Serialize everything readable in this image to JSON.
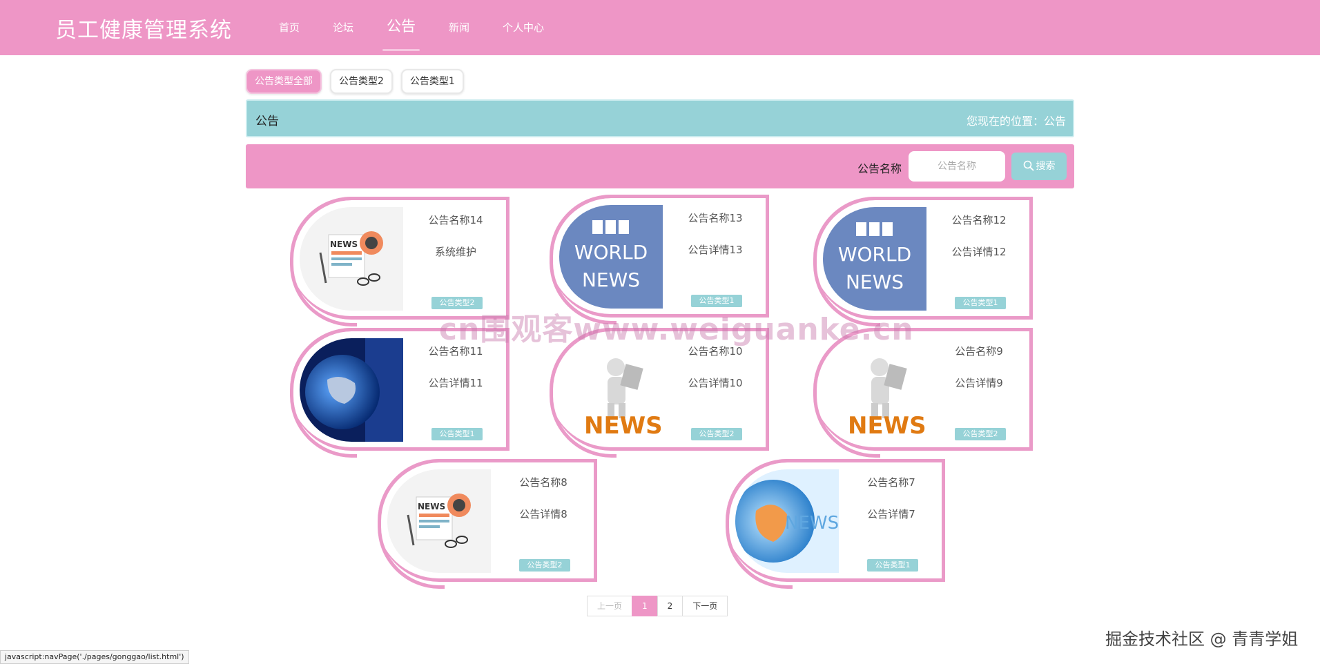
{
  "header": {
    "brand": "员工健康管理系统",
    "nav": [
      "首页",
      "论坛",
      "公告",
      "新闻",
      "个人中心"
    ]
  },
  "filters": [
    "公告类型全部",
    "公告类型2",
    "公告类型1"
  ],
  "breadcrumb": {
    "title": "公告",
    "location": "您现在的位置：公告"
  },
  "search": {
    "label": "公告名称",
    "placeholder": "公告名称",
    "button": "搜索"
  },
  "cards": [
    {
      "name": "公告名称14",
      "desc": "系统维护",
      "type": "公告类型2",
      "image": "news-paper-icon"
    },
    {
      "name": "公告名称13",
      "desc": "公告详情13",
      "type": "公告类型1",
      "image": "bbc-world-news-logo"
    },
    {
      "name": "公告名称12",
      "desc": "公告详情12",
      "type": "公告类型1",
      "image": "bbc-world-news-logo"
    },
    {
      "name": "公告名称11",
      "desc": "公告详情11",
      "type": "公告类型1",
      "image": "globe-studio-image"
    },
    {
      "name": "公告名称10",
      "desc": "公告详情10",
      "type": "公告类型2",
      "image": "news-figure-image"
    },
    {
      "name": "公告名称9",
      "desc": "公告详情9",
      "type": "公告类型2",
      "image": "news-figure-image"
    },
    {
      "name": "公告名称8",
      "desc": "公告详情8",
      "type": "公告类型2",
      "image": "news-paper-icon"
    },
    {
      "name": "公告名称7",
      "desc": "公告详情7",
      "type": "公告类型1",
      "image": "news-globe-image"
    }
  ],
  "image_text": {
    "news": "NEWS",
    "bbc": "BBC",
    "world": "WORLD"
  },
  "pagination": {
    "prev": "上一页",
    "pages": [
      "1",
      "2"
    ],
    "current": "1",
    "next": "下一页"
  },
  "watermark": "cn围观客www.weiguanke.cn",
  "status_url": "javascript:navPage('./pages/gonggao/list.html')",
  "credit": "掘金技术社区 @ 青青学姐",
  "colors": {
    "pink": "#ee96c6",
    "teal": "#96d2d7",
    "card_border": "#ea9ac8"
  }
}
